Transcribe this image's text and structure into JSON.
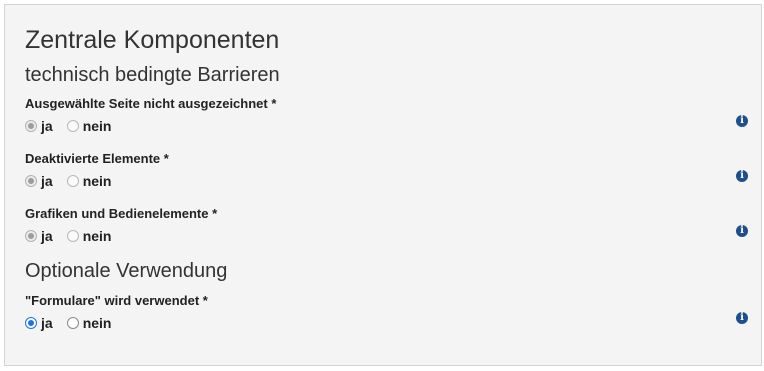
{
  "title": "Zentrale Komponenten",
  "sections": [
    {
      "heading": "technisch bedingte Barrieren",
      "questions": [
        {
          "label": "Ausgewählte Seite nicht ausgezeichnet *",
          "yes": "ja",
          "no": "nein",
          "selected": "ja",
          "disabled": true,
          "info_icon": "info-icon"
        },
        {
          "label": "Deaktivierte Elemente *",
          "yes": "ja",
          "no": "nein",
          "selected": "ja",
          "disabled": true,
          "info_icon": "info-icon"
        },
        {
          "label": "Grafiken und Bedienelemente *",
          "yes": "ja",
          "no": "nein",
          "selected": "ja",
          "disabled": true,
          "info_icon": "info-icon"
        }
      ]
    },
    {
      "heading": "Optionale Verwendung",
      "questions": [
        {
          "label": "\"Formulare\" wird verwendet *",
          "yes": "ja",
          "no": "nein",
          "selected": "ja",
          "disabled": false,
          "info_icon": "info-icon"
        }
      ]
    }
  ],
  "colors": {
    "panel_bg": "#f4f4f4",
    "info_icon": "#1f4e8c",
    "radio_checked": "#1a73e8"
  }
}
